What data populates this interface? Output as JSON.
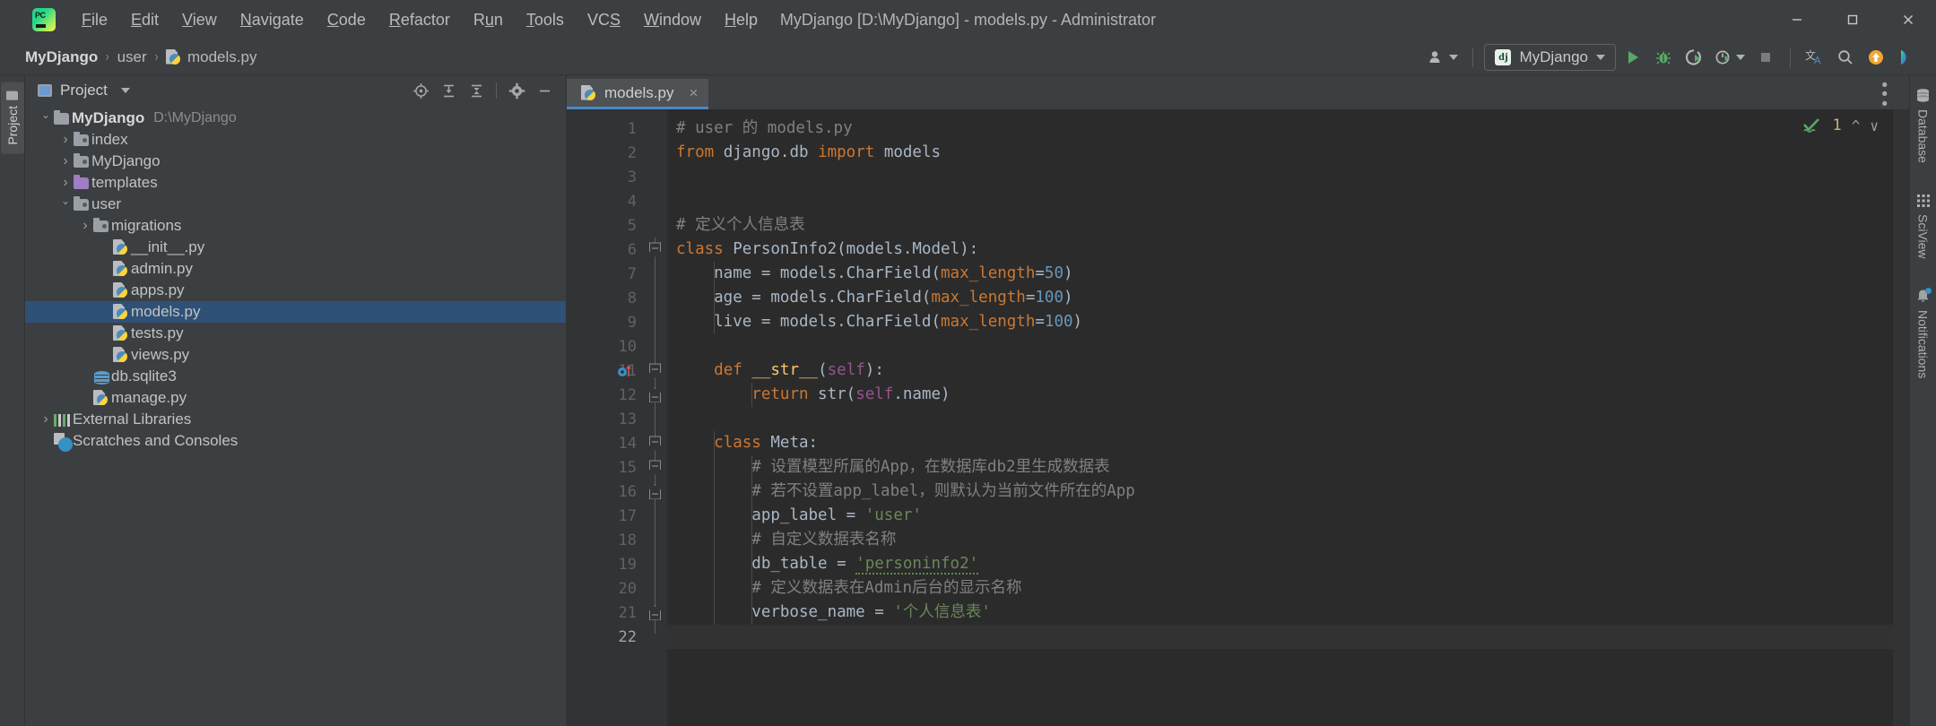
{
  "window": {
    "title": "MyDjango [D:\\MyDjango] - models.py - Administrator",
    "minimize_label": "minimize-window",
    "maximize_label": "maximize-window",
    "close_label": "close-window"
  },
  "menu": {
    "items": [
      {
        "label": "File",
        "mnemonic": "F"
      },
      {
        "label": "Edit",
        "mnemonic": "E"
      },
      {
        "label": "View",
        "mnemonic": "V"
      },
      {
        "label": "Navigate",
        "mnemonic": "N"
      },
      {
        "label": "Code",
        "mnemonic": "C"
      },
      {
        "label": "Refactor",
        "mnemonic": "R"
      },
      {
        "label": "Run",
        "mnemonic": "u"
      },
      {
        "label": "Tools",
        "mnemonic": "T"
      },
      {
        "label": "VCS",
        "mnemonic": "S"
      },
      {
        "label": "Window",
        "mnemonic": "W"
      },
      {
        "label": "Help",
        "mnemonic": "H"
      }
    ]
  },
  "breadcrumb": {
    "items": [
      "MyDjango",
      "user",
      "models.py"
    ],
    "separator": "›"
  },
  "toolbar": {
    "run_config_label": "MyDjango",
    "dj_badge": "dj",
    "icons": [
      "user-settings-icon",
      "run-icon",
      "debug-icon",
      "run-coverage-icon",
      "profile-icon",
      "stop-icon",
      "translate-icon",
      "search-everywhere-icon",
      "updates-icon",
      "ide-features-icon"
    ]
  },
  "left_strip": {
    "project_tab_label": "Project"
  },
  "project_panel": {
    "title": "Project",
    "tool_icons": [
      "locate-icon",
      "expand-all-icon",
      "collapse-all-icon",
      "settings-gear-icon",
      "hide-icon"
    ],
    "tree": [
      {
        "label": "MyDjango",
        "path": "D:\\MyDjango",
        "indent": 0,
        "arrow": "open",
        "icon": "folder",
        "bold": true,
        "selected": false
      },
      {
        "label": "index",
        "path": "",
        "indent": 1,
        "arrow": "closed",
        "icon": "folder-module",
        "bold": false,
        "selected": false
      },
      {
        "label": "MyDjango",
        "path": "",
        "indent": 1,
        "arrow": "closed",
        "icon": "folder-module",
        "bold": false,
        "selected": false
      },
      {
        "label": "templates",
        "path": "",
        "indent": 1,
        "arrow": "closed",
        "icon": "folder-purple",
        "bold": false,
        "selected": false
      },
      {
        "label": "user",
        "path": "",
        "indent": 1,
        "arrow": "open",
        "icon": "folder-module",
        "bold": false,
        "selected": false
      },
      {
        "label": "migrations",
        "path": "",
        "indent": 2,
        "arrow": "closed",
        "icon": "folder-module",
        "bold": false,
        "selected": false
      },
      {
        "label": "__init__.py",
        "path": "",
        "indent": 3,
        "arrow": "none",
        "icon": "python-file",
        "bold": false,
        "selected": false
      },
      {
        "label": "admin.py",
        "path": "",
        "indent": 3,
        "arrow": "none",
        "icon": "python-file",
        "bold": false,
        "selected": false
      },
      {
        "label": "apps.py",
        "path": "",
        "indent": 3,
        "arrow": "none",
        "icon": "python-file",
        "bold": false,
        "selected": false
      },
      {
        "label": "models.py",
        "path": "",
        "indent": 3,
        "arrow": "none",
        "icon": "python-file",
        "bold": false,
        "selected": true
      },
      {
        "label": "tests.py",
        "path": "",
        "indent": 3,
        "arrow": "none",
        "icon": "python-file",
        "bold": false,
        "selected": false
      },
      {
        "label": "views.py",
        "path": "",
        "indent": 3,
        "arrow": "none",
        "icon": "python-file",
        "bold": false,
        "selected": false
      },
      {
        "label": "db.sqlite3",
        "path": "",
        "indent": 2,
        "arrow": "none",
        "icon": "database-file",
        "bold": false,
        "selected": false
      },
      {
        "label": "manage.py",
        "path": "",
        "indent": 2,
        "arrow": "none",
        "icon": "python-file",
        "bold": false,
        "selected": false
      },
      {
        "label": "External Libraries",
        "path": "",
        "indent": 0,
        "arrow": "closed",
        "icon": "libraries",
        "bold": false,
        "selected": false
      },
      {
        "label": "Scratches and Consoles",
        "path": "",
        "indent": 0,
        "arrow": "none",
        "icon": "scratches",
        "bold": false,
        "selected": false
      }
    ]
  },
  "editor": {
    "tab": {
      "label": "models.py",
      "close": "×",
      "icon": "python-file-icon"
    },
    "inspection": {
      "count": "1",
      "status_icon": "inspection-ok-with-warning-icon"
    },
    "total_lines": 22,
    "current_line": 22,
    "lines": [
      {
        "n": 1,
        "text": "# user 的 models.py"
      },
      {
        "n": 2,
        "text": "from django.db import models"
      },
      {
        "n": 3,
        "text": ""
      },
      {
        "n": 4,
        "text": ""
      },
      {
        "n": 5,
        "text": "# 定义个人信息表"
      },
      {
        "n": 6,
        "text": "class PersonInfo2(models.Model):"
      },
      {
        "n": 7,
        "text": "    name = models.CharField(max_length=50)"
      },
      {
        "n": 8,
        "text": "    age = models.CharField(max_length=100)"
      },
      {
        "n": 9,
        "text": "    live = models.CharField(max_length=100)"
      },
      {
        "n": 10,
        "text": ""
      },
      {
        "n": 11,
        "text": "    def __str__(self):"
      },
      {
        "n": 12,
        "text": "        return str(self.name)"
      },
      {
        "n": 13,
        "text": ""
      },
      {
        "n": 14,
        "text": "    class Meta:"
      },
      {
        "n": 15,
        "text": "        # 设置模型所属的App，在数据库db2里生成数据表"
      },
      {
        "n": 16,
        "text": "        # 若不设置app_label，则默认为当前文件所在的App"
      },
      {
        "n": 17,
        "text": "        app_label = 'user'"
      },
      {
        "n": 18,
        "text": "        # 自定义数据表名称"
      },
      {
        "n": 19,
        "text": "        db_table = 'personinfo2'"
      },
      {
        "n": 20,
        "text": "        # 定义数据表在Admin后台的显示名称"
      },
      {
        "n": 21,
        "text": "        verbose_name = '个人信息表'"
      },
      {
        "n": 22,
        "text": ""
      }
    ]
  },
  "right_strip": {
    "tabs": [
      {
        "label": "Database",
        "icon": "database-icon",
        "badge": false
      },
      {
        "label": "SciView",
        "icon": "grid-icon",
        "badge": false
      },
      {
        "label": "Notifications",
        "icon": "bell-icon",
        "badge": true
      }
    ]
  },
  "colors": {
    "chrome": "#3c3f41",
    "editor_bg": "#2b2b2b",
    "gutter_bg": "#313335",
    "selection": "#2f5177",
    "accent_blue": "#4a88c7",
    "keyword": "#cc7832",
    "string": "#6a8759",
    "comment": "#808080",
    "number": "#6897bb",
    "function": "#ffc66d",
    "self_kw": "#94558d",
    "default_text": "#a9b7c6",
    "warning": "#c9b477"
  }
}
